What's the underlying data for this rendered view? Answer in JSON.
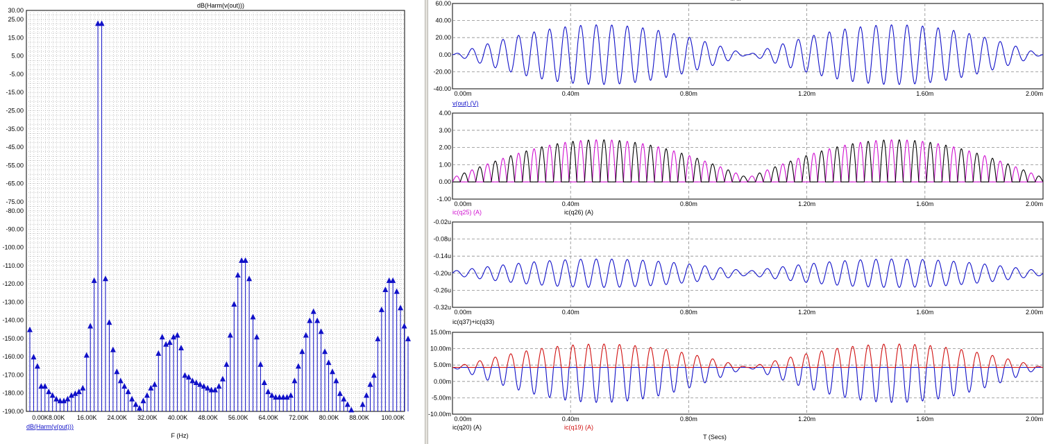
{
  "colors": {
    "blue": "#1010c8",
    "magenta": "#d010d0",
    "black": "#000000",
    "red": "#d01010",
    "grid": "#8a8a8a"
  },
  "left_panel": {
    "title": "dB(Harm(v(out)))",
    "xlabel": "F (Hz)",
    "trace_label": "dB(Harm(v(out)))"
  },
  "right_panel": {
    "title": "... ...",
    "xlabel": "T (Secs)"
  },
  "chart_data": [
    {
      "type": "scatter",
      "style": "stem-with-triangle-markers",
      "title": "dB(Harm(v(out)))",
      "xlabel": "F (Hz)",
      "ylabel": "",
      "xlim": [
        0,
        100000
      ],
      "ylim": [
        -190,
        30
      ],
      "x_ticks": [
        "0.00K",
        "8.00K",
        "16.00K",
        "24.00K",
        "32.00K",
        "40.00K",
        "48.00K",
        "56.00K",
        "64.00K",
        "72.00K",
        "80.00K",
        "88.00K",
        "100.00K"
      ],
      "x_tick_values": [
        0,
        8000,
        16000,
        24000,
        32000,
        40000,
        48000,
        56000,
        64000,
        72000,
        80000,
        88000,
        100000
      ],
      "y_ticks": [
        "30.00",
        "25.00",
        "15.00",
        "5.00",
        "-5.00",
        "-15.00",
        "-25.00",
        "-35.00",
        "-45.00",
        "-55.00",
        "-65.00",
        "-75.00",
        "-80.00",
        "-90.00",
        "-100.00",
        "-110.00",
        "-120.00",
        "-130.00",
        "-140.00",
        "-150.00",
        "-160.00",
        "-170.00",
        "-180.00",
        "-190.00"
      ],
      "y_tick_values": [
        30,
        25,
        15,
        5,
        -5,
        -15,
        -25,
        -35,
        -45,
        -55,
        -65,
        -75,
        -80,
        -90,
        -100,
        -110,
        -120,
        -130,
        -140,
        -150,
        -160,
        -170,
        -180,
        -190
      ],
      "grid": true,
      "series": [
        {
          "name": "dB(Harm(v(out)))",
          "x": [
            0,
            1000,
            2000,
            3000,
            4000,
            5000,
            6000,
            7000,
            8000,
            9000,
            10000,
            11000,
            12000,
            13000,
            14000,
            15000,
            16000,
            17000,
            18000,
            19000,
            20000,
            21000,
            22000,
            23000,
            24000,
            25000,
            26000,
            27000,
            28000,
            29000,
            30000,
            31000,
            32000,
            33000,
            34000,
            35000,
            36000,
            37000,
            38000,
            39000,
            40000,
            41000,
            42000,
            43000,
            44000,
            45000,
            46000,
            47000,
            48000,
            49000,
            50000,
            51000,
            52000,
            53000,
            54000,
            55000,
            56000,
            57000,
            58000,
            59000,
            60000,
            61000,
            62000,
            63000,
            64000,
            65000,
            66000,
            67000,
            68000,
            69000,
            70000,
            71000,
            72000,
            73000,
            74000,
            75000,
            76000,
            77000,
            78000,
            79000,
            80000,
            81000,
            82000,
            83000,
            84000,
            85000,
            86000,
            87000,
            88000,
            89000,
            90000,
            91000,
            92000,
            93000,
            94000,
            95000,
            96000,
            97000,
            98000,
            99000,
            100000
          ],
          "y": [
            -145,
            -160,
            -165,
            -176,
            -176,
            -179,
            -181,
            -183,
            -184,
            -184,
            -183,
            -181,
            -180,
            -179,
            -177,
            -159,
            -143,
            -118,
            23,
            23,
            -117,
            -141,
            -156,
            -168,
            -173,
            -176,
            -179,
            -183,
            -186,
            -188,
            -184,
            -181,
            -177,
            -175,
            -158,
            -149,
            -153,
            -152,
            -149,
            -148,
            -155,
            -170,
            -171,
            -173,
            -174,
            -175,
            -176,
            -177,
            -178,
            -178,
            -176,
            -172,
            -164,
            -148,
            -131,
            -115,
            -107,
            -107,
            -117,
            -138,
            -149,
            -164,
            -174,
            -179,
            -181,
            -182,
            -182,
            -182,
            -182,
            -181,
            -173,
            -165,
            -157,
            -148,
            -140,
            -135,
            -140,
            -146,
            -157,
            -163,
            -168,
            -173,
            -180,
            -183,
            -186,
            -189,
            -191,
            -193,
            -186,
            -181,
            -175,
            -170,
            -150,
            -134,
            -123,
            -118,
            -118,
            -124,
            -133,
            -143,
            -150
          ]
        }
      ]
    },
    {
      "type": "line",
      "title": "",
      "xlabel": "",
      "ylabel": "",
      "xlim": [
        0,
        0.002
      ],
      "ylim": [
        -40,
        60
      ],
      "x_ticks": [
        "0.00m",
        "0.40m",
        "0.80m",
        "1.20m",
        "1.60m",
        "2.00m"
      ],
      "y_ticks": [
        "60.00",
        "40.00",
        "20.00",
        "0.00",
        "-20.00",
        "-40.00"
      ],
      "grid": true,
      "legend": [
        "v(out) (V)"
      ],
      "series": [
        {
          "name": "v(out) (V)",
          "frequency_hz": 19000,
          "envelope_period_s": 0.001,
          "amplitude_max": 35
        }
      ]
    },
    {
      "type": "line",
      "title": "",
      "xlabel": "",
      "ylabel": "",
      "xlim": [
        0,
        0.002
      ],
      "ylim": [
        -1,
        4
      ],
      "x_ticks": [
        "0.00m",
        "0.40m",
        "0.80m",
        "1.20m",
        "1.60m",
        "2.00m"
      ],
      "y_ticks": [
        "4.00",
        "3.00",
        "2.00",
        "1.00",
        "0.00",
        "-1.00"
      ],
      "grid": true,
      "legend": [
        "ic(q25) (A)",
        "ic(q26) (A)"
      ],
      "series": [
        {
          "name": "ic(q25) (A)",
          "frequency_hz": 19000,
          "envelope_period_s": 0.001,
          "amplitude_max": 2.45
        },
        {
          "name": "ic(q26) (A)",
          "frequency_hz": 19000,
          "envelope_period_s": 0.001,
          "amplitude_max": 2.45
        }
      ]
    },
    {
      "type": "line",
      "title": "",
      "xlabel": "",
      "ylabel": "",
      "xlim": [
        0,
        0.002
      ],
      "ylim": [
        -0.32,
        -0.02
      ],
      "x_ticks": [
        "0.00m",
        "0.40m",
        "0.80m",
        "1.20m",
        "1.60m",
        "2.00m"
      ],
      "y_ticks": [
        "-0.02u",
        "-0.08u",
        "-0.14u",
        "-0.20u",
        "-0.26u",
        "-0.32u"
      ],
      "grid": true,
      "legend": [
        "ic(q37)+ic(q33)"
      ],
      "series": [
        {
          "name": "ic(q37)+ic(q33)",
          "frequency_hz": 19000,
          "envelope_period_s": 0.001,
          "offset": -0.2,
          "amplitude_max": 0.05
        }
      ]
    },
    {
      "type": "line",
      "title": "",
      "xlabel": "T (Secs)",
      "ylabel": "",
      "xlim": [
        0,
        0.002
      ],
      "ylim": [
        -20,
        15
      ],
      "x_ticks": [
        "0.00m",
        "0.40m",
        "0.80m",
        "1.20m",
        "1.60m",
        "2.00m"
      ],
      "y_ticks": [
        "15.00m",
        "10.00m",
        "5.00m",
        "0.00m",
        "-5.00m",
        "-10.00m"
      ],
      "grid": true,
      "legend": [
        "ic(q20) (A)",
        "ic(q19) (A)"
      ],
      "series": [
        {
          "name": "ic(q20) (A)",
          "frequency_hz": 19000,
          "envelope_period_s": 0.001,
          "amplitude_max": 15
        },
        {
          "name": "ic(q19) (A)",
          "frequency_hz": 19000,
          "envelope_period_s": 0.001,
          "amplitude_max": 10
        }
      ]
    }
  ]
}
